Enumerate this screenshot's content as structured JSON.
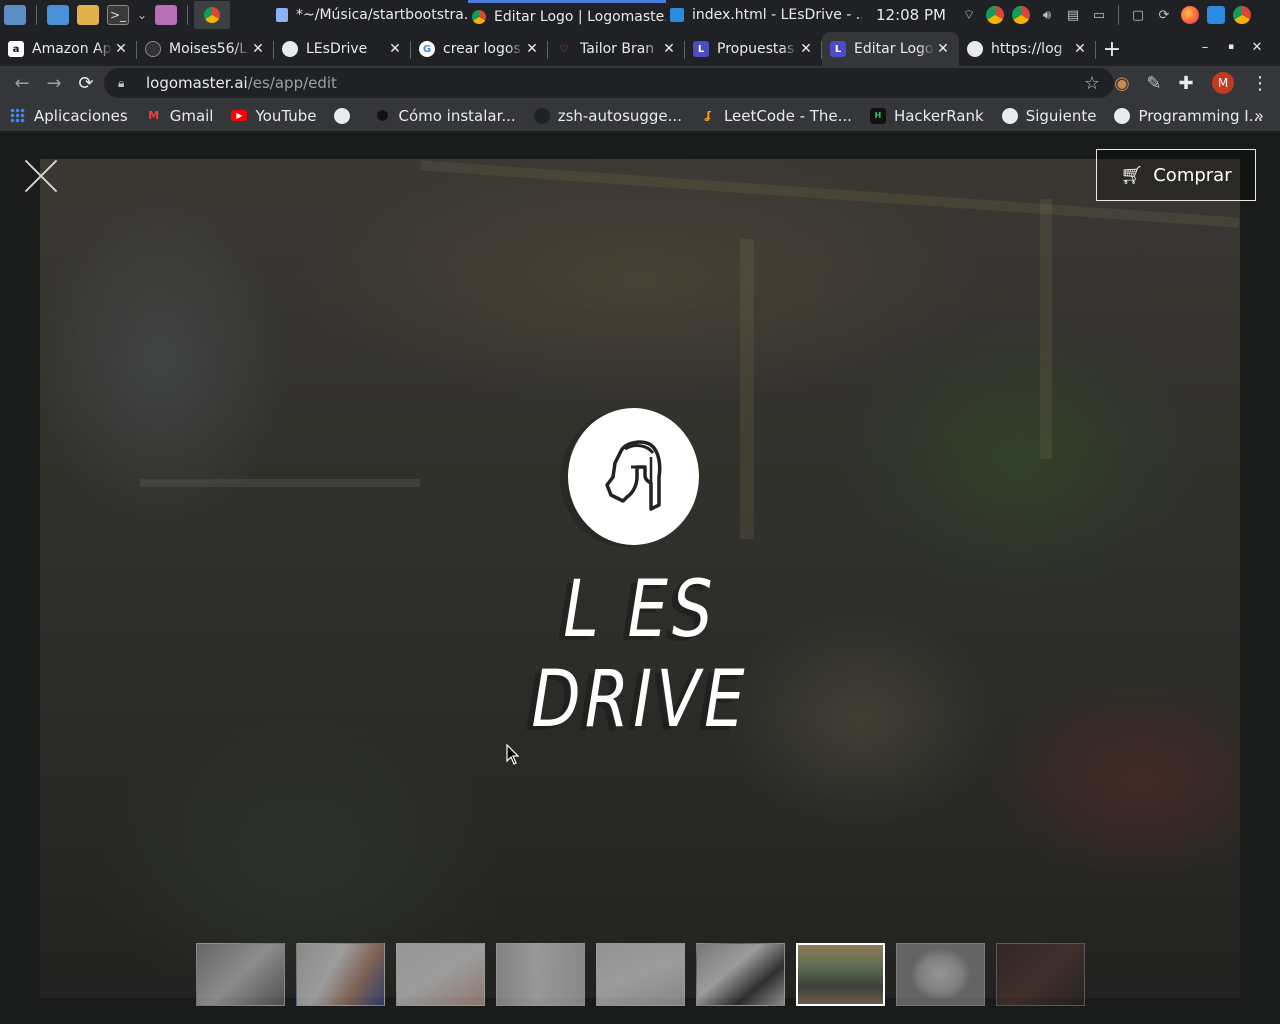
{
  "taskbar": {
    "windows": [
      {
        "title": "*~/Música/startbootstra...",
        "icon": "document-icon"
      },
      {
        "title": "Editar Logo | Logomaste...",
        "icon": "chrome-icon"
      },
      {
        "title": "index.html - LEsDrive - ...",
        "icon": "vscode-icon"
      }
    ],
    "clock": "12:08 PM"
  },
  "tabs": [
    {
      "title": "Amazon Ap",
      "icon": "amazon-icon"
    },
    {
      "title": "Moises56/L",
      "icon": "github-icon"
    },
    {
      "title": "LEsDrive",
      "icon": "globe-icon"
    },
    {
      "title": "crear logos",
      "icon": "google-icon"
    },
    {
      "title": "Tailor Bran",
      "icon": "tailor-brands-icon"
    },
    {
      "title": "Propuestas",
      "icon": "logomaster-icon"
    },
    {
      "title": "Editar Logo",
      "icon": "logomaster-icon",
      "active": true
    },
    {
      "title": "https://log",
      "icon": "globe-icon"
    }
  ],
  "omnibox": {
    "domain": "logomaster.ai",
    "path": "/es/app/edit"
  },
  "profile": {
    "initial": "M"
  },
  "bookmarks": [
    {
      "label": "Aplicaciones",
      "icon": "apps-grid-icon"
    },
    {
      "label": "Gmail",
      "icon": "gmail-icon"
    },
    {
      "label": "YouTube",
      "icon": "youtube-icon"
    },
    {
      "label": "",
      "icon": "globe-icon"
    },
    {
      "label": "Cómo instalar...",
      "icon": "hexagon-icon"
    },
    {
      "label": "zsh-autosugge...",
      "icon": "github-icon"
    },
    {
      "label": "LeetCode - The...",
      "icon": "leetcode-icon"
    },
    {
      "label": "HackerRank",
      "icon": "hackerrank-icon"
    },
    {
      "label": "Siguiente",
      "icon": "globe-icon"
    },
    {
      "label": "Programming I...",
      "icon": "globe-icon"
    }
  ],
  "page": {
    "buy_label": "Comprar",
    "logo_text": "L ES DRIVE",
    "logo_icon": "spartan-helmet-icon",
    "thumbnails": [
      {
        "name": "signboard"
      },
      {
        "name": "phone-in-hand"
      },
      {
        "name": "hand-card"
      },
      {
        "name": "packaging-box"
      },
      {
        "name": "envelope"
      },
      {
        "name": "stationery-set"
      },
      {
        "name": "storefront",
        "active": true
      },
      {
        "name": "t-shirt"
      },
      {
        "name": "dark-mockup"
      }
    ]
  },
  "colors": {
    "chrome_dark": "#202124",
    "chrome_toolbar": "#35363a",
    "text": "#e8eaed",
    "profile": "#c5391f"
  }
}
